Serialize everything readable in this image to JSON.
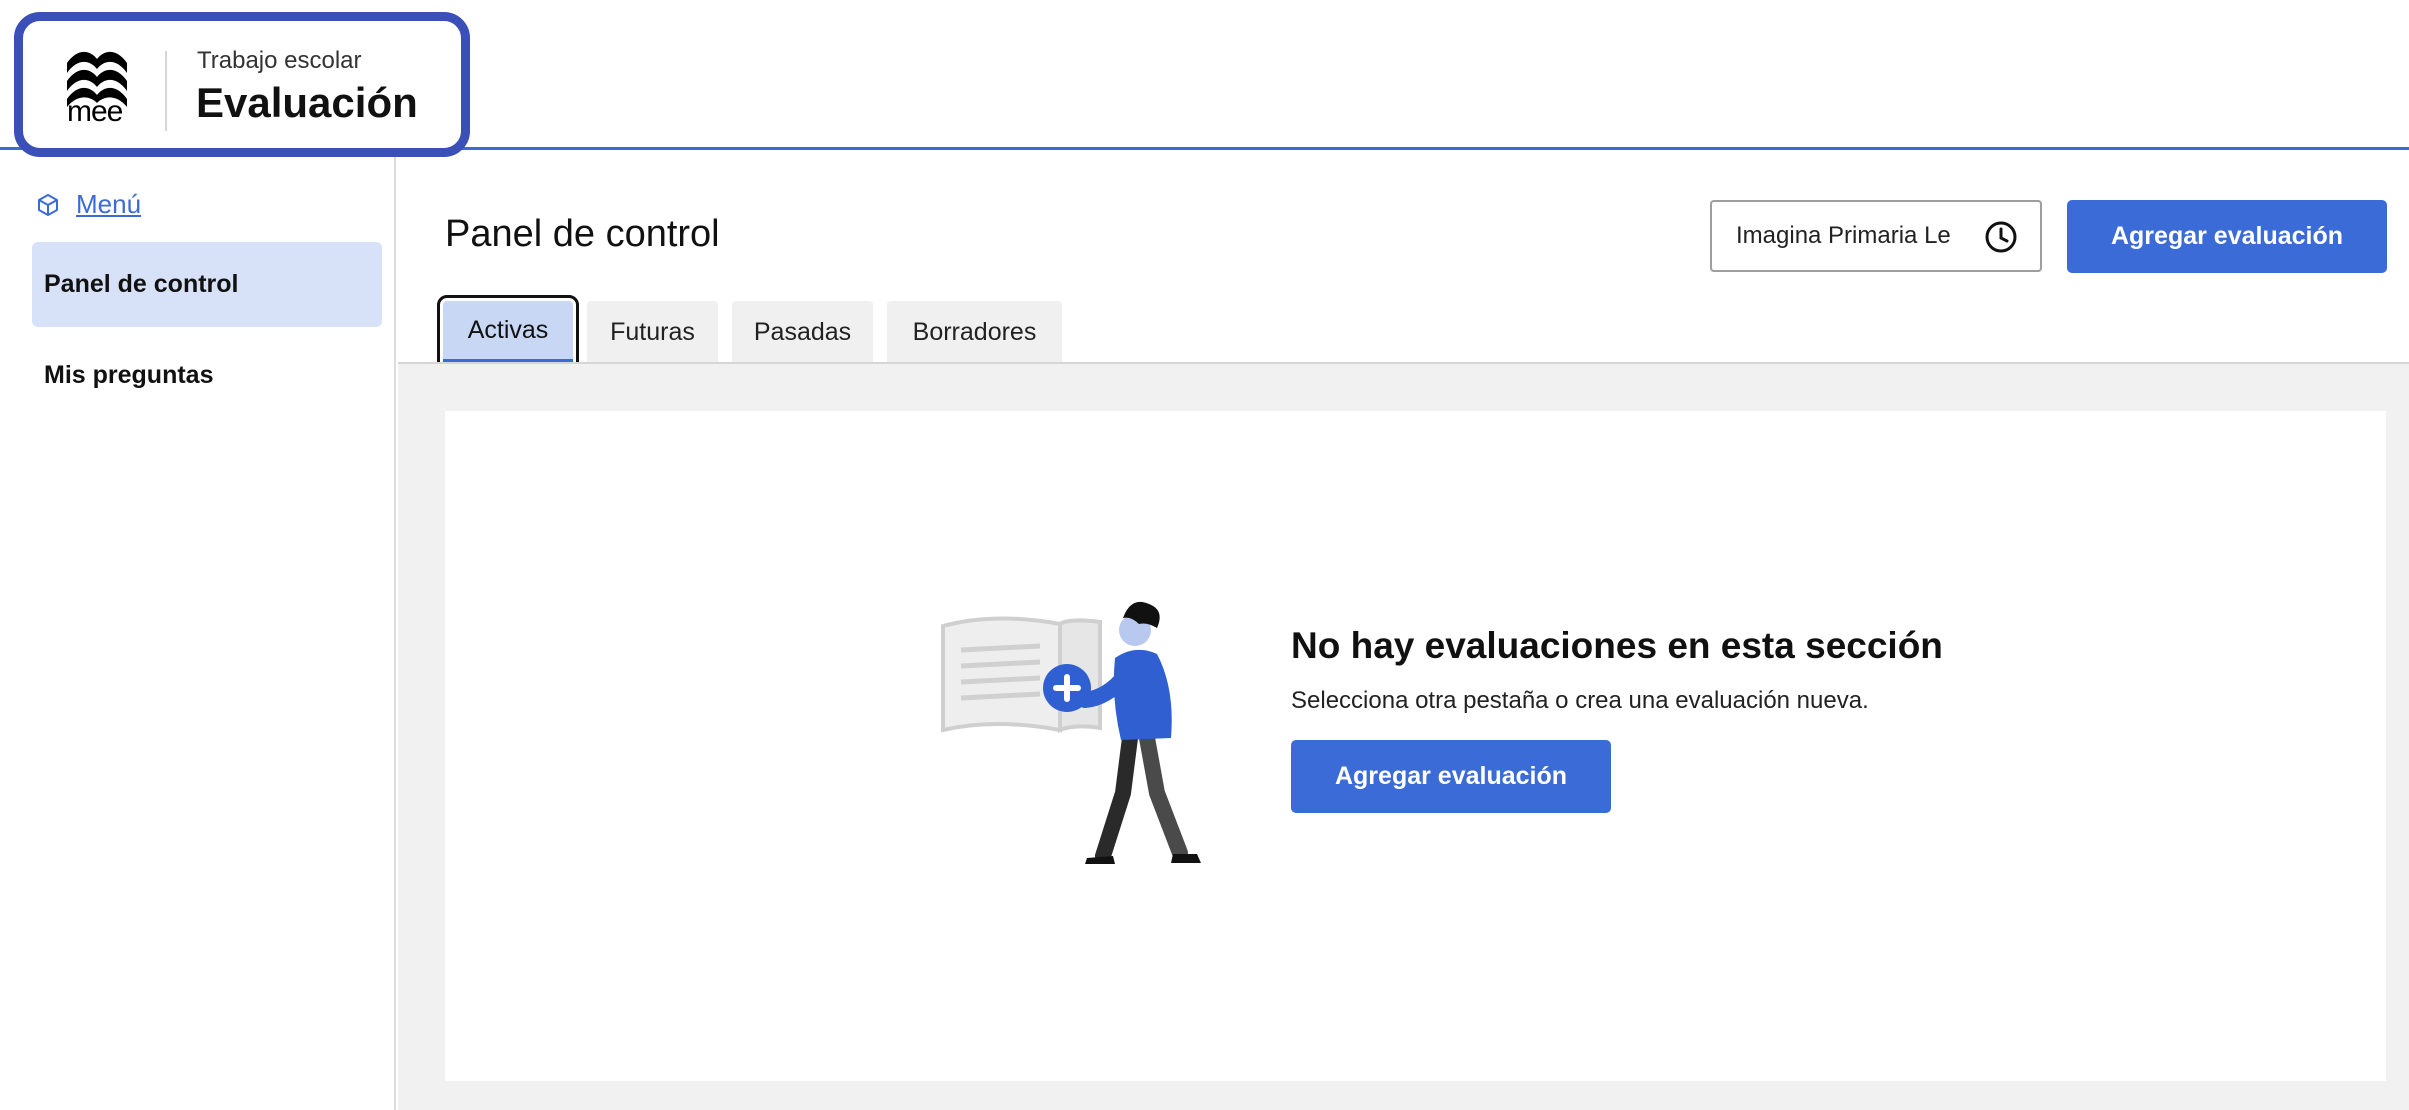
{
  "brand": {
    "logo_text": "mee",
    "subtitle": "Trabajo escolar",
    "title": "Evaluación"
  },
  "sidebar": {
    "menu_label": "Menú",
    "items": [
      {
        "label": "Panel de control",
        "active": true
      },
      {
        "label": "Mis preguntas",
        "active": false
      }
    ]
  },
  "main": {
    "page_title": "Panel de control",
    "course_select": {
      "value": "Imagina Primaria Le"
    },
    "add_button_label": "Agregar evaluación",
    "tabs": [
      {
        "label": "Activas",
        "active": true
      },
      {
        "label": "Futuras",
        "active": false
      },
      {
        "label": "Pasadas",
        "active": false
      },
      {
        "label": "Borradores",
        "active": false
      }
    ],
    "empty_state": {
      "title": "No hay evaluaciones en esta sección",
      "description": "Selecciona otra pestaña o crea una evaluación nueva.",
      "button_label": "Agregar evaluación"
    }
  },
  "colors": {
    "accent": "#3b6bd6",
    "brand_border": "#3a4fb8",
    "active_nav_bg": "#d7e1f7",
    "active_tab_bg": "#c8d7f4"
  },
  "icons": {
    "menu": "cube-icon",
    "select": "clock-icon",
    "logo": "mee-waves-logo"
  }
}
